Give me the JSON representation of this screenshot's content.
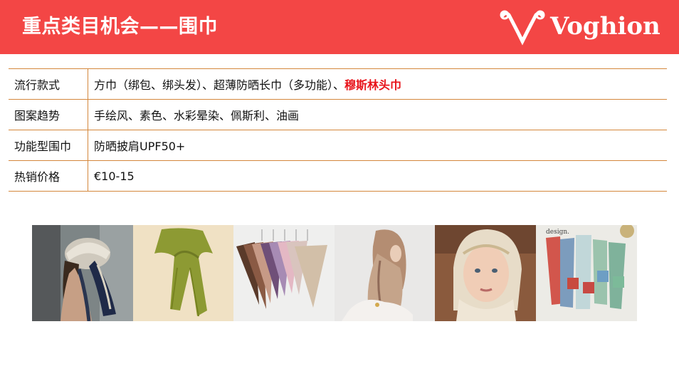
{
  "header": {
    "title": "重点类目机会——围巾",
    "brand": "Voghion",
    "colors": {
      "header_bg": "#f34645",
      "table_rule": "#d4873c",
      "highlight": "#e8141b"
    }
  },
  "table": {
    "rows": [
      {
        "label": "流行款式",
        "value": "方巾（绑包、绑头发）、超薄防晒长巾（多功能）、",
        "highlight": "穆斯林头巾"
      },
      {
        "label": "图案趋势",
        "value": "手绘风、素色、水彩晕染、佩斯利、油画"
      },
      {
        "label": "功能型围巾",
        "value": "防晒披肩UPF50+"
      },
      {
        "label": "热销价格",
        "value": "€10-15"
      }
    ]
  },
  "gallery": {
    "photo_6_caption": "design."
  }
}
